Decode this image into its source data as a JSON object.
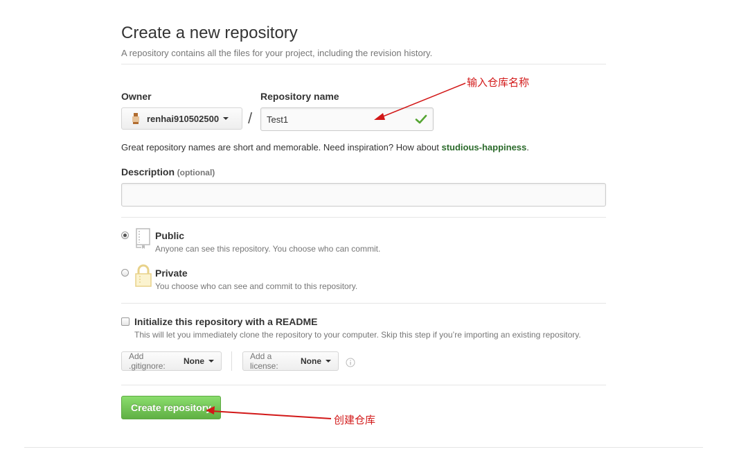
{
  "header": {
    "title": "Create a new repository",
    "subtitle": "A repository contains all the files for your project, including the revision history."
  },
  "owner": {
    "label": "Owner",
    "value": "renhai910502500"
  },
  "repo_name": {
    "label": "Repository name",
    "value": "Test1",
    "separator": "/"
  },
  "hint": {
    "text": "Great repository names are short and memorable. Need inspiration? How about ",
    "suggestion": "studious-happiness",
    "end": "."
  },
  "description": {
    "label": "Description",
    "optional": "(optional)",
    "value": ""
  },
  "visibility": {
    "public": {
      "title": "Public",
      "note": "Anyone can see this repository. You choose who can commit.",
      "selected": true
    },
    "private": {
      "title": "Private",
      "note": "You choose who can see and commit to this repository.",
      "selected": false
    }
  },
  "readme": {
    "title": "Initialize this repository with a README",
    "note": "This will let you immediately clone the repository to your computer. Skip this step if you’re importing an existing repository.",
    "checked": false
  },
  "gitignore": {
    "prefix": "Add .gitignore:",
    "value": "None"
  },
  "license": {
    "prefix": "Add a license:",
    "value": "None"
  },
  "create_button": {
    "label": "Create repository"
  },
  "annotations": {
    "name_note": "输入仓库名称",
    "create_note": "创建仓库"
  },
  "colors": {
    "accent_green": "#60b044",
    "suggestion_green": "#2b6a2b",
    "annotation_red": "#d21818",
    "check_green": "#55a532"
  },
  "icons": [
    "check-icon",
    "repo-book-icon",
    "lock-icon",
    "info-icon",
    "caret-down-icon"
  ]
}
